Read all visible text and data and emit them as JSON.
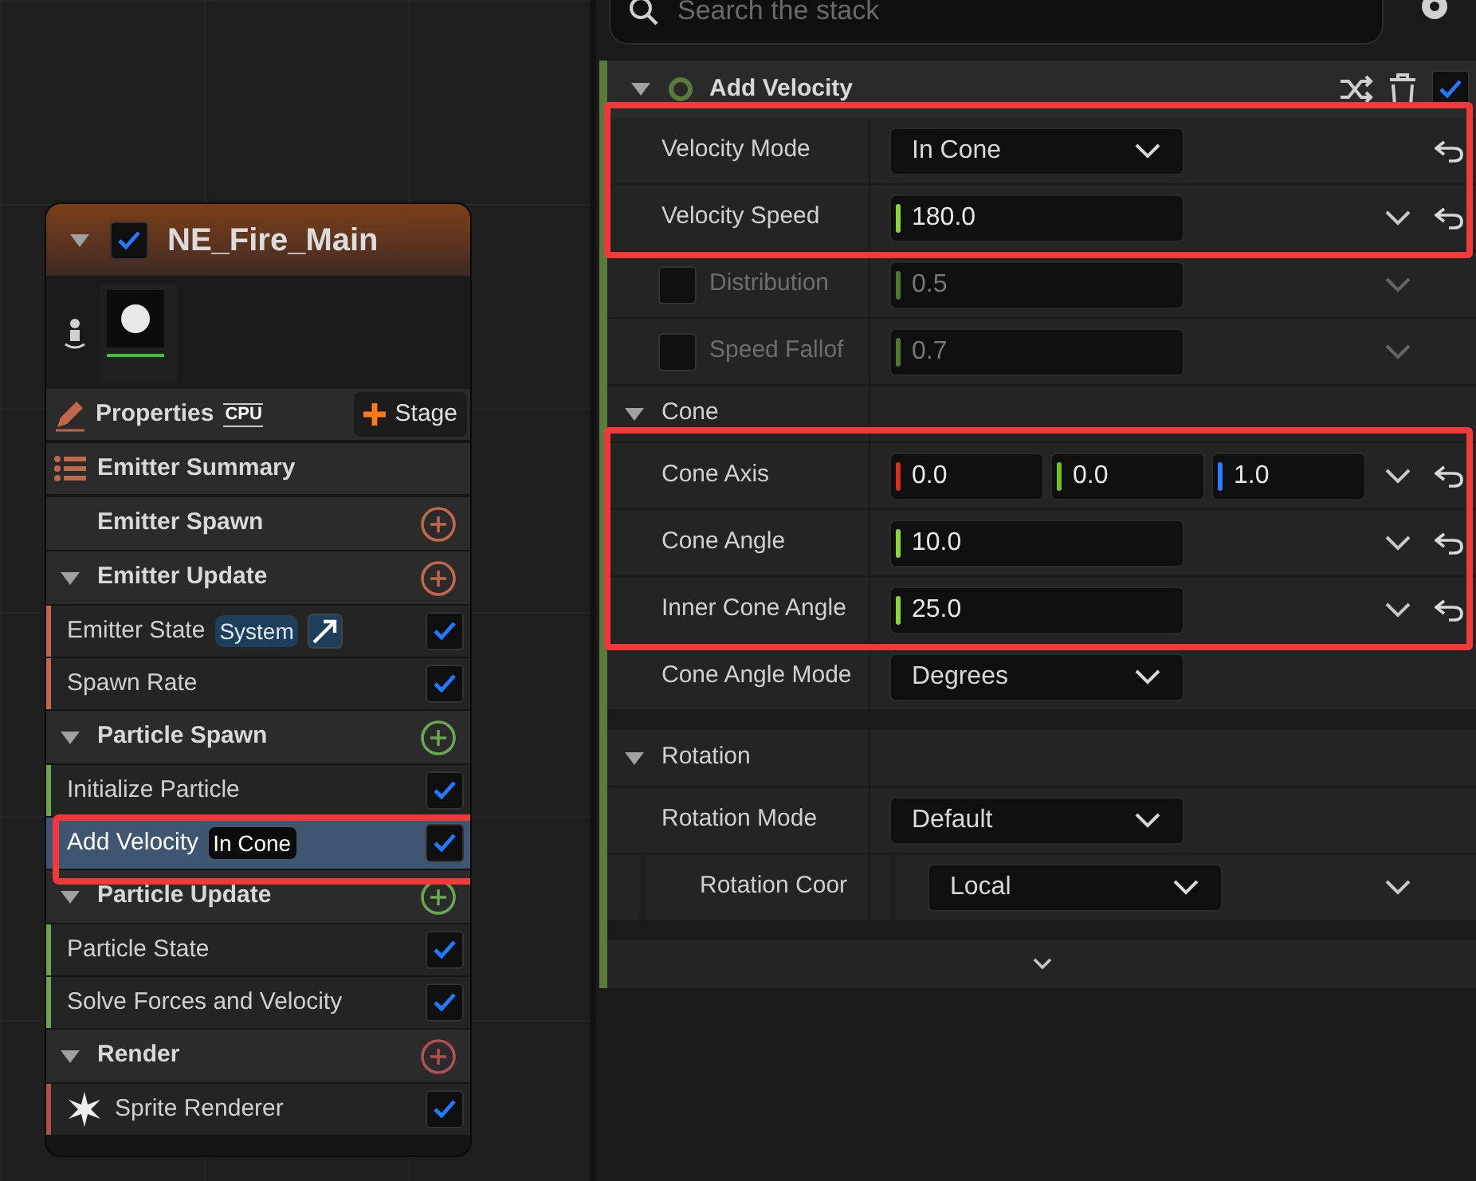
{
  "node": {
    "title": "NE_Fire_Main",
    "enabled": true,
    "toolbar": {
      "properties": "Properties",
      "sim_target": "CPU",
      "add_stage": "Stage"
    },
    "sections": [
      {
        "kind": "summary",
        "label": "Emitter Summary"
      },
      {
        "kind": "stage",
        "label": "Emitter Spawn",
        "color": "#c0694a"
      },
      {
        "kind": "stage",
        "label": "Emitter Update",
        "expanded": true,
        "color": "#c0694a",
        "items": [
          {
            "kind": "module",
            "label": "Emitter State",
            "badge": {
              "text": "System",
              "kind": "scope"
            },
            "linked": true,
            "enabled": true,
            "selected": false,
            "highlighted": false
          },
          {
            "kind": "module",
            "label": "Spawn Rate",
            "enabled": true,
            "selected": false,
            "highlighted": false
          }
        ]
      },
      {
        "kind": "stage",
        "label": "Particle Spawn",
        "expanded": true,
        "color": "#6aa84f",
        "items": [
          {
            "kind": "module",
            "label": "Initialize Particle",
            "enabled": true,
            "selected": false,
            "highlighted": false
          },
          {
            "kind": "module",
            "label": "Add Velocity",
            "badge": {
              "text": "In Cone",
              "kind": "value"
            },
            "enabled": true,
            "selected": true,
            "highlighted": true
          }
        ]
      },
      {
        "kind": "stage",
        "label": "Particle Update",
        "expanded": true,
        "color": "#6aa84f",
        "items": [
          {
            "kind": "module",
            "label": "Particle State",
            "enabled": true,
            "selected": false,
            "highlighted": false
          },
          {
            "kind": "module",
            "label": "Solve Forces and Velocity",
            "enabled": true,
            "selected": false,
            "highlighted": false
          }
        ]
      },
      {
        "kind": "stage",
        "label": "Render",
        "expanded": true,
        "color": "#b0504f",
        "items": [
          {
            "kind": "renderer",
            "label": "Sprite Renderer",
            "enabled": true,
            "selected": false,
            "highlighted": false
          }
        ]
      }
    ]
  },
  "stack": {
    "search": {
      "placeholder": "Search the stack"
    },
    "module": {
      "title": "Add Velocity",
      "enabled": true,
      "expanded": true
    },
    "rows": [
      {
        "kind": "enum",
        "label": "Velocity Mode",
        "value": "In Cone",
        "chevron": false,
        "reset": true,
        "highlighted": true
      },
      {
        "kind": "float",
        "label": "Velocity Speed",
        "value": "180.0",
        "chevron": true,
        "reset": true,
        "highlighted": true
      },
      {
        "kind": "float",
        "label": "Distribution",
        "value": "0.5",
        "override": false,
        "chevron": true,
        "reset": false,
        "highlighted": false
      },
      {
        "kind": "float",
        "label": "Speed Fallof",
        "value": "0.7",
        "override": false,
        "chevron": true,
        "reset": false,
        "highlighted": false
      },
      {
        "kind": "group",
        "label": "Cone",
        "expanded": true
      },
      {
        "kind": "vector",
        "label": "Cone Axis",
        "values": [
          {
            "value": "0.0",
            "color": "#d6301c"
          },
          {
            "value": "0.0",
            "color": "#6fc21e"
          },
          {
            "value": "1.0",
            "color": "#2f7bff"
          }
        ],
        "chevron": true,
        "reset": true,
        "highlighted": true
      },
      {
        "kind": "float",
        "label": "Cone Angle",
        "value": "10.0",
        "chevron": true,
        "reset": true,
        "highlighted": true
      },
      {
        "kind": "float",
        "label": "Inner Cone Angle",
        "value": "25.0",
        "chevron": true,
        "reset": true,
        "highlighted": true
      },
      {
        "kind": "enum",
        "label": "Cone Angle Mode",
        "value": "Degrees",
        "chevron": false,
        "reset": false,
        "highlighted": false
      },
      {
        "kind": "gap"
      },
      {
        "kind": "group",
        "label": "Rotation",
        "expanded": true
      },
      {
        "kind": "enum",
        "label": "Rotation Mode",
        "value": "Default",
        "chevron": false,
        "reset": false,
        "highlighted": false,
        "children": [
          {
            "kind": "enum",
            "label": "Rotation Coor",
            "value": "Local",
            "chevron": true,
            "reset": false,
            "highlighted": false
          }
        ]
      },
      {
        "kind": "gap"
      },
      {
        "kind": "footer"
      }
    ]
  }
}
